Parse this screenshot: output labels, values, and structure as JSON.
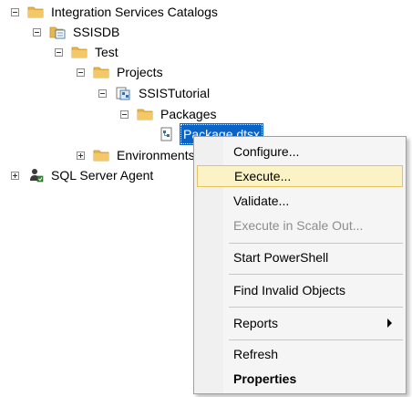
{
  "tree": {
    "nodes": [
      {
        "id": "integration-services-catalogs",
        "label": "Integration Services Catalogs",
        "expander": "minus",
        "icon": "folder-icon"
      },
      {
        "id": "ssisdb",
        "label": "SSISDB",
        "expander": "minus",
        "icon": "catalog-icon"
      },
      {
        "id": "test",
        "label": "Test",
        "expander": "minus",
        "icon": "folder-icon"
      },
      {
        "id": "projects",
        "label": "Projects",
        "expander": "minus",
        "icon": "folder-icon"
      },
      {
        "id": "ssistutorial",
        "label": "SSISTutorial",
        "expander": "minus",
        "icon": "project-icon"
      },
      {
        "id": "packages",
        "label": "Packages",
        "expander": "minus",
        "icon": "folder-icon"
      },
      {
        "id": "package-dtsx",
        "label": "Package.dtsx",
        "expander": "none",
        "icon": "package-icon",
        "selected": true
      },
      {
        "id": "environments",
        "label": "Environments",
        "expander": "plus",
        "icon": "folder-icon"
      },
      {
        "id": "sql-server-agent",
        "label": "SQL Server Agent",
        "expander": "plus",
        "icon": "agent-icon"
      }
    ]
  },
  "context_menu": {
    "items": {
      "configure": "Configure...",
      "execute": "Execute...",
      "validate": "Validate...",
      "execute_scale_out": "Execute in Scale Out...",
      "start_powershell": "Start PowerShell",
      "find_invalid_objects": "Find Invalid Objects",
      "reports": "Reports",
      "refresh": "Refresh",
      "properties": "Properties"
    },
    "highlighted": "Execute...",
    "disabled": [
      "Execute in Scale Out..."
    ]
  },
  "colors": {
    "selection": "#0a64c8",
    "folder": "#e8b64a",
    "menu_highlight": "#fbf3c5",
    "menu_highlight_border": "#e5c365"
  }
}
